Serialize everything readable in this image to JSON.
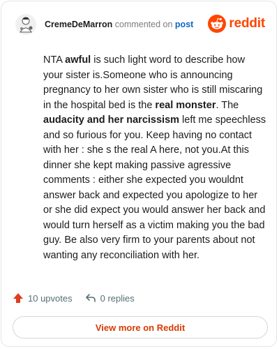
{
  "header": {
    "username": "CremeDeMarron",
    "action_text": "commented on",
    "post_link": "post",
    "brand_name": "reddit"
  },
  "comment": {
    "segments": [
      {
        "text": "NTA ",
        "bold": false
      },
      {
        "text": "awful",
        "bold": true
      },
      {
        "text": " is such light word to describe how your sister is.Someone who is announcing pregnancy to her own sister who is still miscaring in the hospital bed is the ",
        "bold": false
      },
      {
        "text": "real monster",
        "bold": true
      },
      {
        "text": ". The ",
        "bold": false
      },
      {
        "text": "audacity and her narcissism",
        "bold": true
      },
      {
        "text": " left me speechless and so furious for you. Keep having no contact with her : she s the real A here, not you.At this dinner she kept making passive agressive comments : either she expected you wouldnt answer back and expected you apologize to her or she did expect you would answer her back and would turn herself as a victim making you the bad guy. Be also very firm to your parents about not wanting any reconciliation with her.",
        "bold": false
      }
    ]
  },
  "actions": {
    "upvotes": "10 upvotes",
    "replies": "0 replies"
  },
  "footer": {
    "view_more_label": "View more on Reddit"
  },
  "icons": {
    "avatar": "avatar-icon",
    "brand": "reddit-logo-icon",
    "upvote": "upvote-arrow-icon",
    "reply": "reply-arrow-icon"
  },
  "colors": {
    "brand": "#ff4500",
    "upvote": "#e03c1e",
    "link": "#0f65c6",
    "view_more": "#d93a00"
  }
}
